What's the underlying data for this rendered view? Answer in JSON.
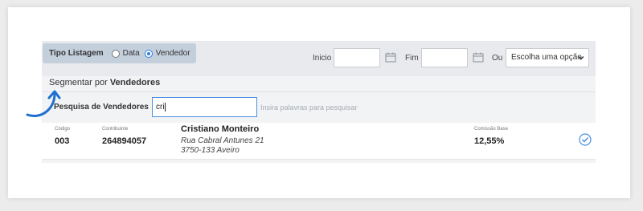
{
  "filter": {
    "tipo_label": "Tipo Listagem",
    "options": [
      "Data",
      "Vendedor"
    ],
    "selected": "Vendedor",
    "inicio_label": "Inicio",
    "fim_label": "Fim",
    "ou_label": "Ou",
    "select_value": "Escolha uma opção"
  },
  "segment": {
    "prefix": "Segmentar por",
    "bold": "Vendedores"
  },
  "search": {
    "label": "Pesquisa de Vendedores",
    "value": "cri",
    "hint": "Insira palavras para pesquisar"
  },
  "result": {
    "codigo_label": "Código",
    "codigo": "003",
    "contribuinte_label": "Contribuinte",
    "contribuinte": "264894057",
    "name": "Cristiano Monteiro",
    "address1": "Rua Cabral Antunes 21",
    "address2": "3750-133 Aveiro",
    "comissao_label": "Comissão Base",
    "comissao": "12,55%"
  },
  "colors": {
    "accent": "#2a7de1",
    "annotation_arrow": "#1f6fd1"
  },
  "icons": [
    "calendar-icon",
    "chevron-down-icon",
    "check-circle-icon",
    "annotation-arrow-icon"
  ]
}
